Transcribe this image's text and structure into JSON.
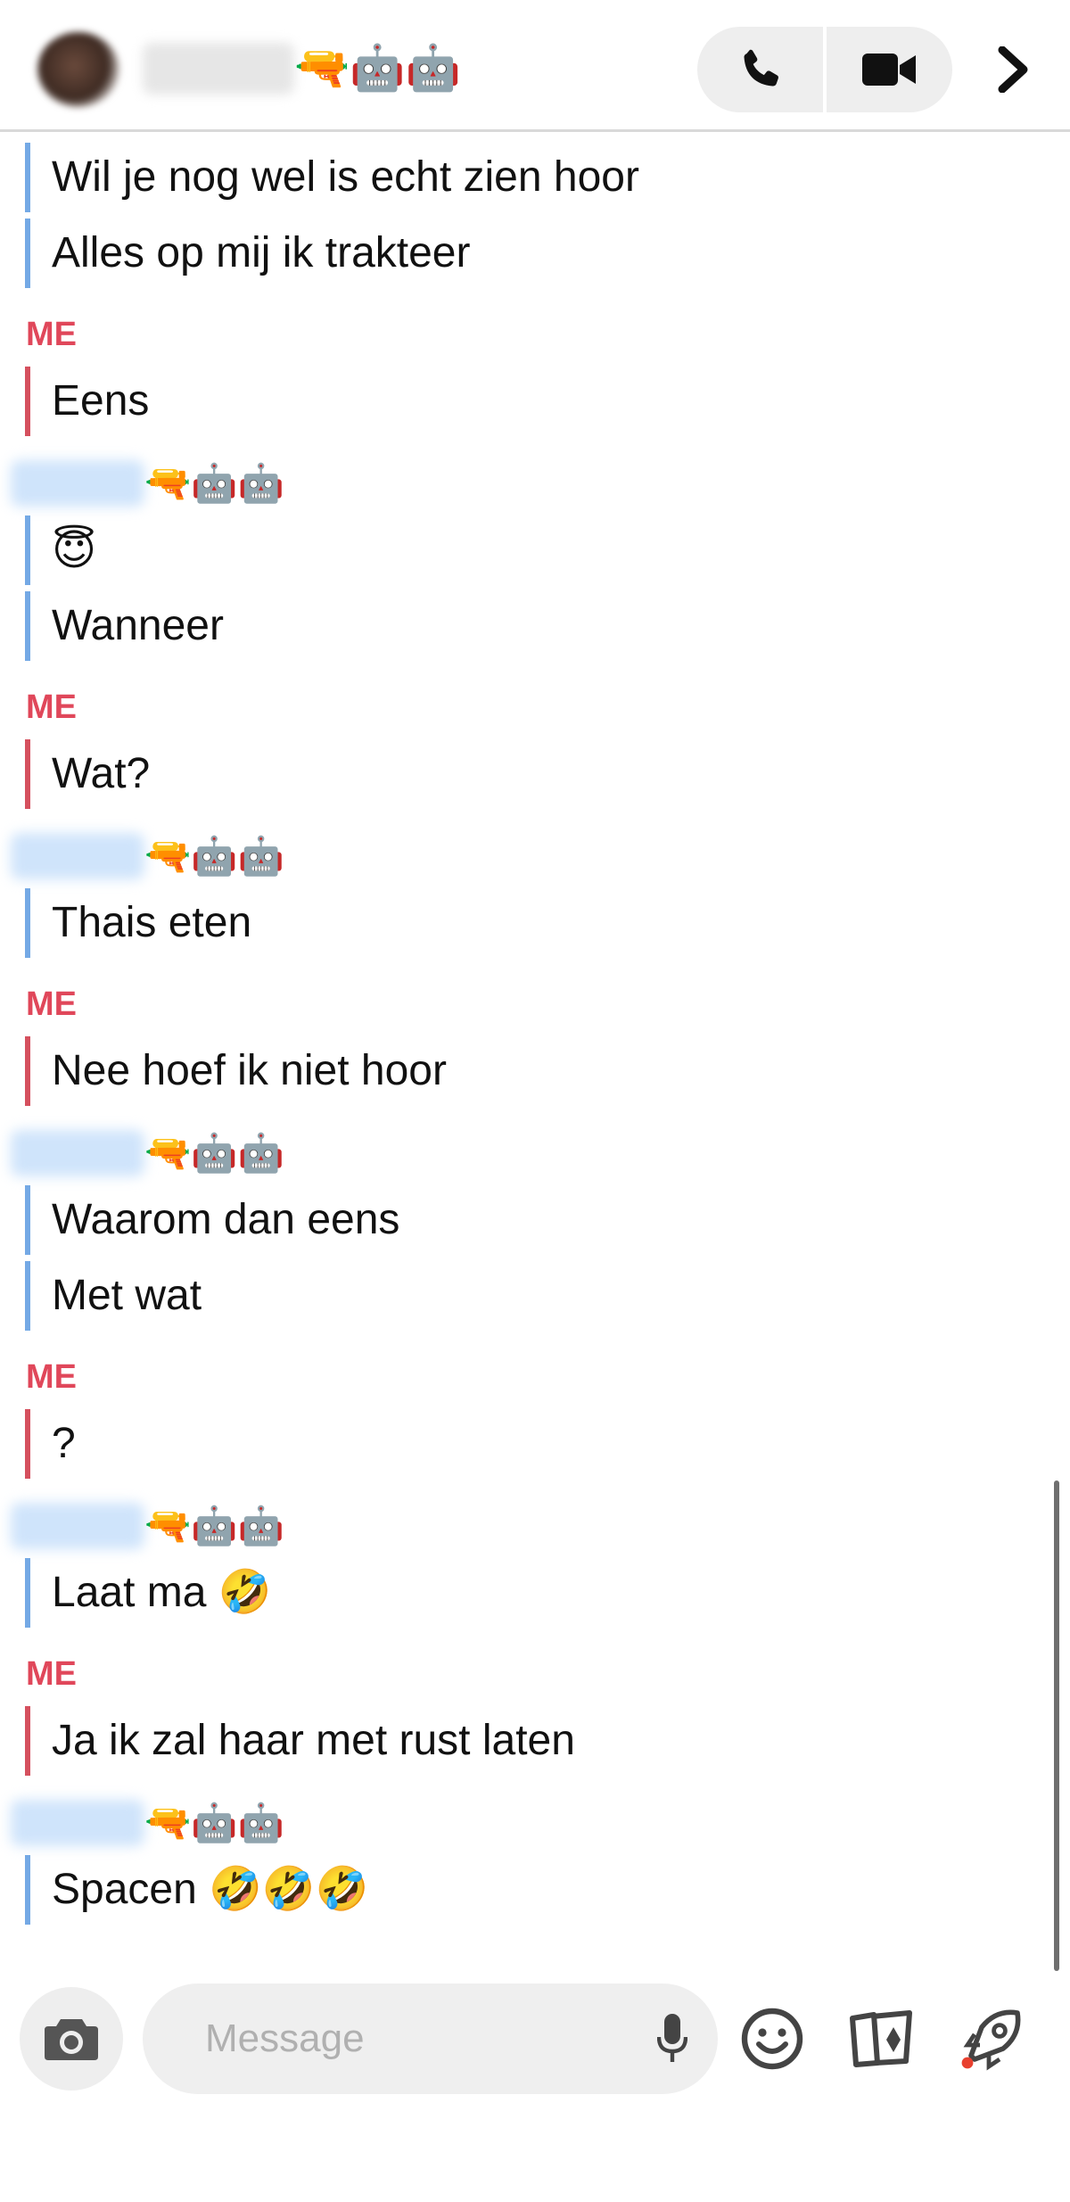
{
  "header": {
    "contact_name_emojis": "🔫🤖🤖",
    "icons": {
      "avatar": "contact-avatar-blurred",
      "call": "phone-icon",
      "video": "video-camera-icon",
      "more": "chevron-right-icon"
    }
  },
  "thread": {
    "friend_name_emojis": "🔫🤖🤖",
    "me_label": "ME",
    "messages": [
      "Wil je nog wel is echt zien hoor",
      "Alles op mij ik trakteer",
      "Eens",
      "😇",
      "Wanneer",
      "Wat?",
      "Thais eten",
      "Nee hoef ik niet hoor",
      "Waarom dan eens",
      "Met wat",
      "?",
      "Laat ma 🤣",
      "Ja ik zal haar met rust laten",
      "Spacen 🤣🤣🤣"
    ],
    "colors": {
      "me_accent": "#d5505e",
      "me_label": "#e0475a",
      "friend_accent": "#74a9e5"
    }
  },
  "composer": {
    "placeholder": "Message",
    "icons": {
      "camera": "camera-icon",
      "mic": "microphone-icon",
      "emoji": "smiley-icon",
      "cards": "cards-icon",
      "bitmoji": "bitmoji-rocket-icon"
    }
  }
}
